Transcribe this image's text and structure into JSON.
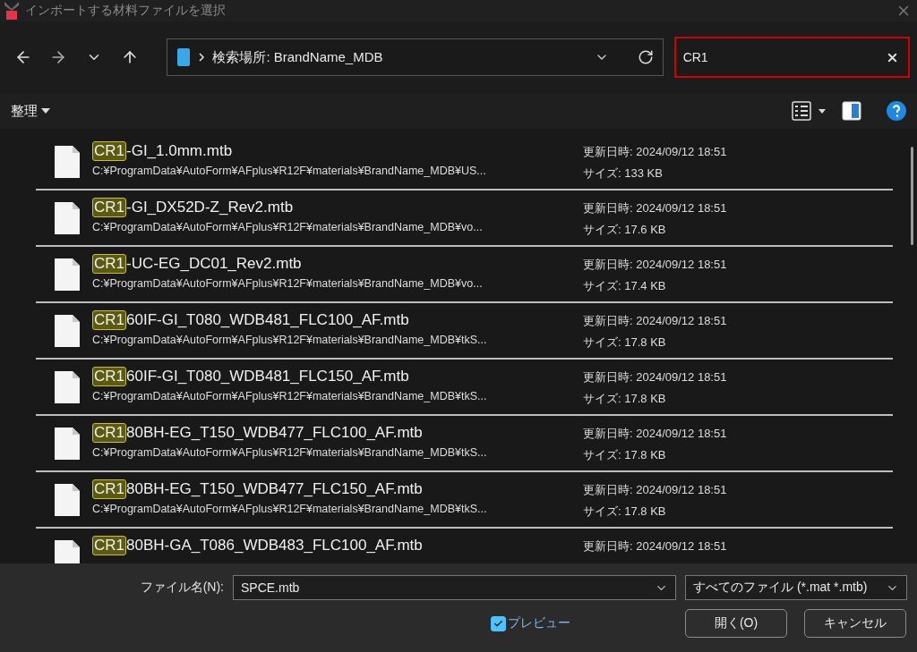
{
  "window": {
    "title": "インポートする材料ファイルを選択"
  },
  "address": {
    "location": "検索場所: BrandName_MDB"
  },
  "search": {
    "value": "CR1"
  },
  "command_bar": {
    "organize": "整理"
  },
  "files": [
    {
      "highlight": "CR1",
      "name_rest": "-GI_1.0mm.mtb",
      "path": "C:¥ProgramData¥AutoForm¥AFplus¥R12F¥materials¥BrandName_MDB¥US...",
      "modified": "更新日時: 2024/09/12 18:51",
      "size": "サイズ: 133 KB"
    },
    {
      "highlight": "CR1",
      "name_rest": "-GI_DX52D-Z_Rev2.mtb",
      "path": "C:¥ProgramData¥AutoForm¥AFplus¥R12F¥materials¥BrandName_MDB¥vo...",
      "modified": "更新日時: 2024/09/12 18:51",
      "size": "サイズ: 17.6 KB"
    },
    {
      "highlight": "CR1",
      "name_rest": "-UC-EG_DC01_Rev2.mtb",
      "path": "C:¥ProgramData¥AutoForm¥AFplus¥R12F¥materials¥BrandName_MDB¥vo...",
      "modified": "更新日時: 2024/09/12 18:51",
      "size": "サイズ: 17.4 KB"
    },
    {
      "highlight": "CR1",
      "name_rest": "60IF-GI_T080_WDB481_FLC100_AF.mtb",
      "path": "C:¥ProgramData¥AutoForm¥AFplus¥R12F¥materials¥BrandName_MDB¥tkS...",
      "modified": "更新日時: 2024/09/12 18:51",
      "size": "サイズ: 17.8 KB"
    },
    {
      "highlight": "CR1",
      "name_rest": "60IF-GI_T080_WDB481_FLC150_AF.mtb",
      "path": "C:¥ProgramData¥AutoForm¥AFplus¥R12F¥materials¥BrandName_MDB¥tkS...",
      "modified": "更新日時: 2024/09/12 18:51",
      "size": "サイズ: 17.8 KB"
    },
    {
      "highlight": "CR1",
      "name_rest": "80BH-EG_T150_WDB477_FLC100_AF.mtb",
      "path": "C:¥ProgramData¥AutoForm¥AFplus¥R12F¥materials¥BrandName_MDB¥tkS...",
      "modified": "更新日時: 2024/09/12 18:51",
      "size": "サイズ: 17.8 KB"
    },
    {
      "highlight": "CR1",
      "name_rest": "80BH-EG_T150_WDB477_FLC150_AF.mtb",
      "path": "C:¥ProgramData¥AutoForm¥AFplus¥R12F¥materials¥BrandName_MDB¥tkS...",
      "modified": "更新日時: 2024/09/12 18:51",
      "size": "サイズ: 17.8 KB"
    },
    {
      "highlight": "CR1",
      "name_rest": "80BH-GA_T086_WDB483_FLC100_AF.mtb",
      "modified": "更新日時: 2024/09/12 18:51"
    }
  ],
  "footer": {
    "filename_label": "ファイル名(N):",
    "filename_value": "SPCE.mtb",
    "filter": "すべてのファイル (*.mat *.mtb)",
    "preview": {
      "label": "プレビュー",
      "checked": true
    },
    "buttons": [
      "開く(O)",
      "キャンセル"
    ]
  }
}
